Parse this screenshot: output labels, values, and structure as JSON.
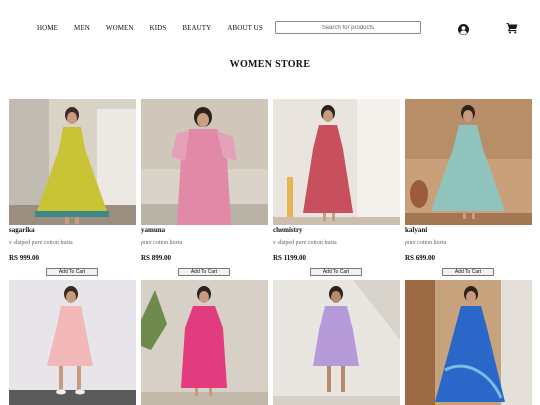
{
  "nav": {
    "links": [
      "HOME",
      "MEN",
      "WOMEN",
      "KIDS",
      "BEAUTY",
      "ABOUT US"
    ],
    "search_placeholder": "Search for products",
    "user_icon": "user-circle-icon",
    "cart_icon": "shopping-cart-icon"
  },
  "page": {
    "title": "WOMEN STORE"
  },
  "products": [
    {
      "name": "sagarika",
      "description": "v shaped pure cotton kurta",
      "price": "RS 999.00",
      "button": "Add To Cart",
      "dress_color": "#c8c436",
      "bg_color": "#d9d2c7"
    },
    {
      "name": "yamuna",
      "description": "pure cotton kurta",
      "price": "RS 899.00",
      "button": "Add To Cart",
      "dress_color": "#e289a8",
      "bg_color": "#d8d2c8"
    },
    {
      "name": "chemistry",
      "description": "v shaped pure cotton kurta",
      "price": "RS 1199.00",
      "button": "Add To Cart",
      "dress_color": "#c84f5e",
      "bg_color": "#e9e4de"
    },
    {
      "name": "kalyani",
      "description": "pure cotton kurta",
      "price": "RS 699.00",
      "button": "Add To Cart",
      "dress_color": "#8fc3bd",
      "bg_color": "#c9a07a"
    },
    {
      "dress_color": "#f1b7b9",
      "bg_color": "#e7e5ea"
    },
    {
      "dress_color": "#e23b7f",
      "bg_color": "#d6d0c6"
    },
    {
      "dress_color": "#b79ad8",
      "bg_color": "#e9e6e1"
    },
    {
      "dress_color": "#2a67c9",
      "bg_color": "#c7a37d"
    }
  ]
}
